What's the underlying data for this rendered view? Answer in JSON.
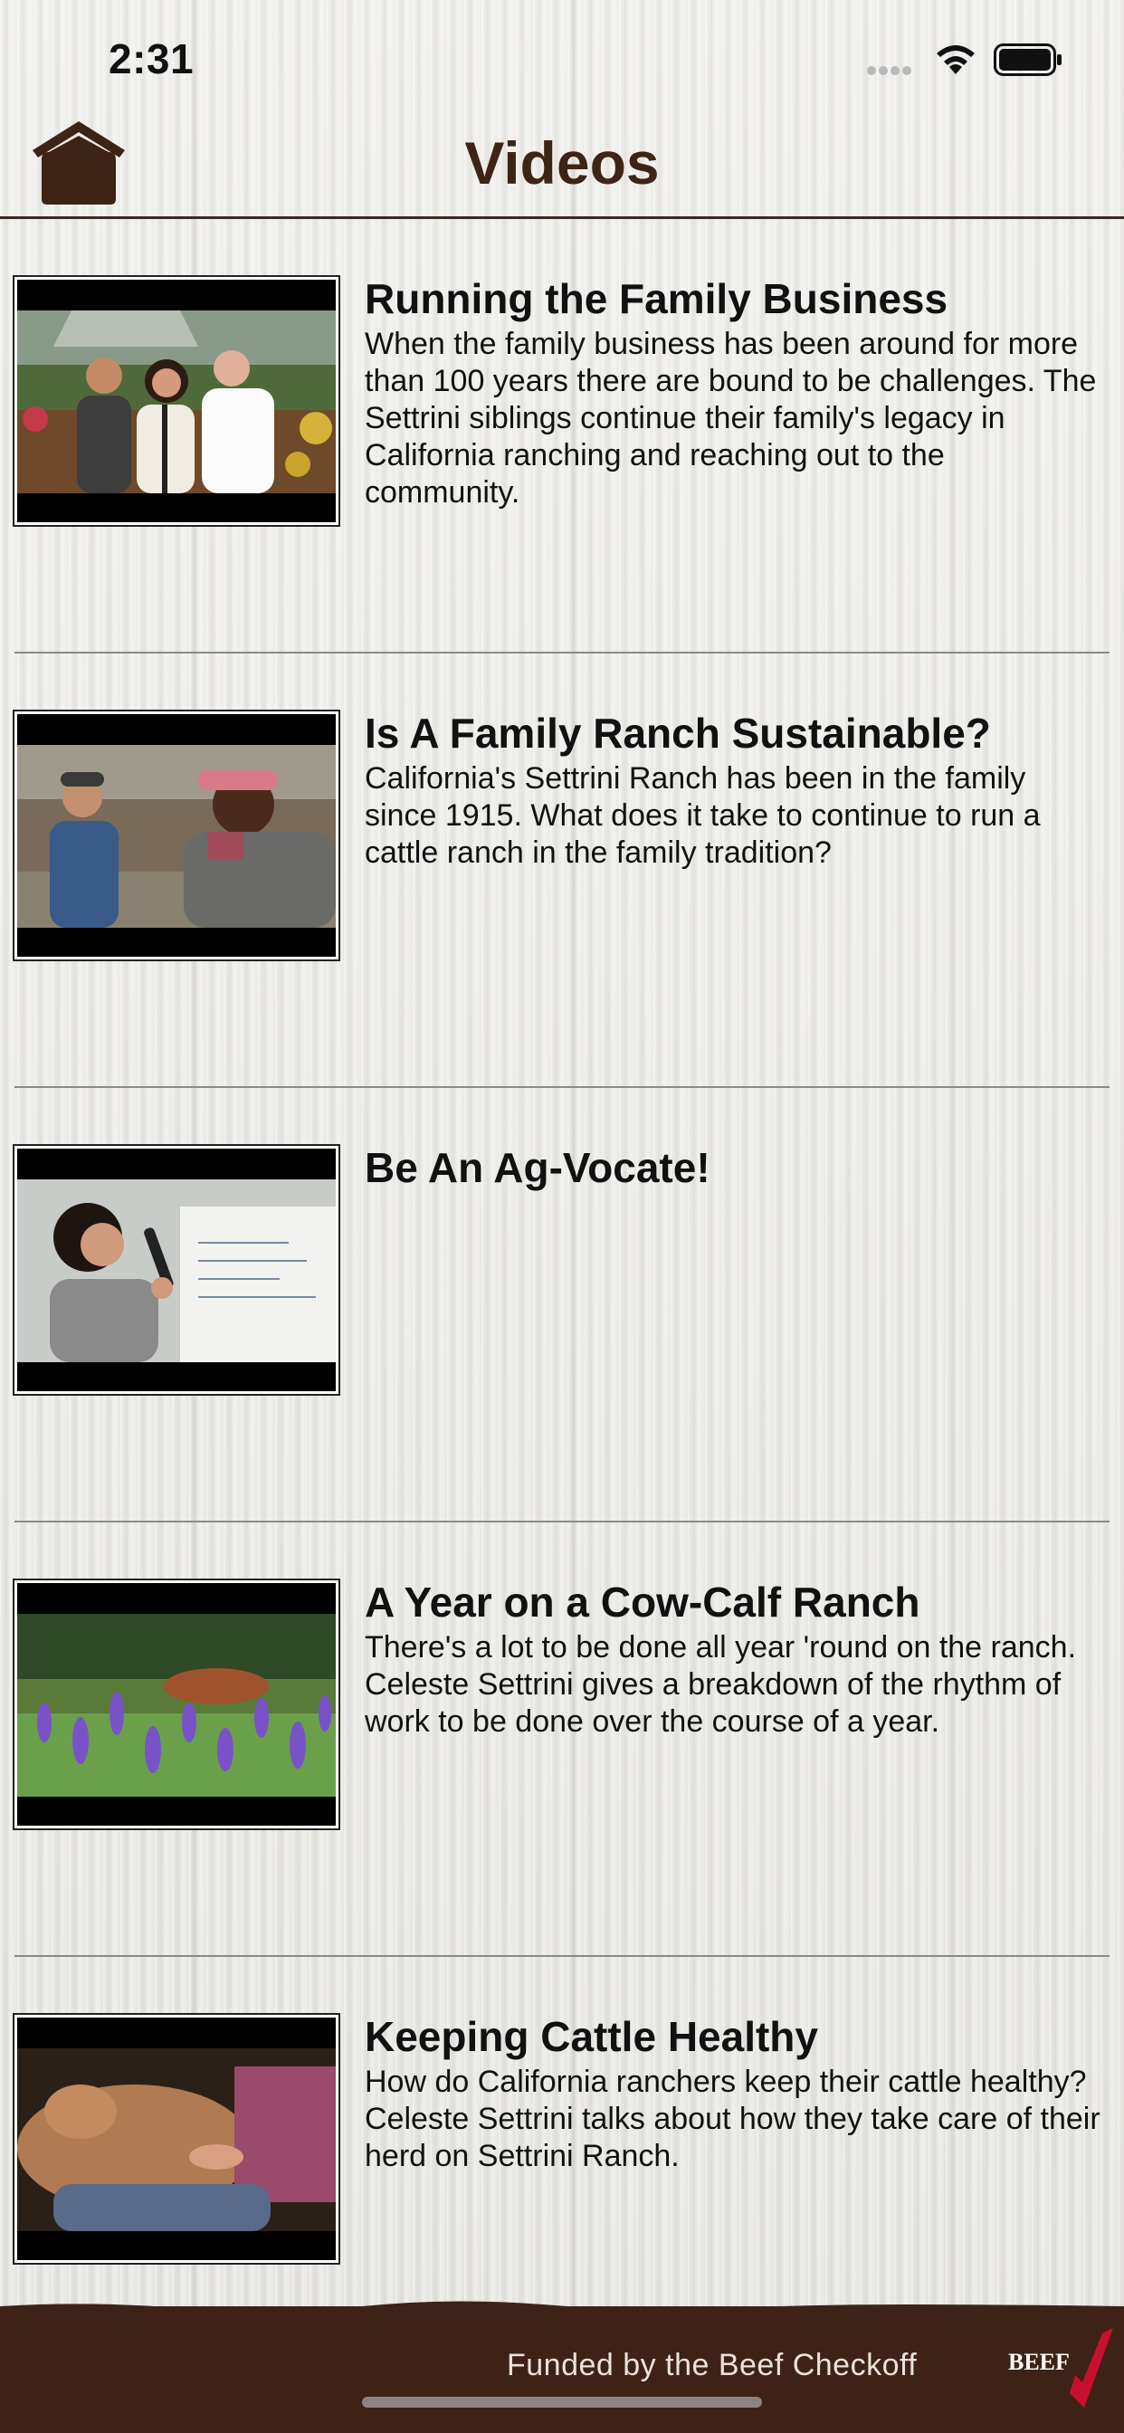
{
  "status_bar": {
    "time": "2:31"
  },
  "header": {
    "title": "Videos",
    "home_icon": "home-icon"
  },
  "videos": [
    {
      "title": "Running the Family Business",
      "description": "When the family business has been around for more than 100 years there are bound to be challenges. The Settrini siblings continue their family's legacy in California ranching and reaching out to the community."
    },
    {
      "title": "Is A Family Ranch Sustainable?",
      "description": "California's Settrini Ranch has been in the family since 1915. What does it take to continue to run a cattle ranch in the family tradition?"
    },
    {
      "title": "Be An Ag-Vocate!",
      "description": ""
    },
    {
      "title": "A Year on a Cow-Calf Ranch",
      "description": "There's a lot to be done all year 'round on the ranch. Celeste Settrini gives a breakdown of the rhythm of work to be done over the course of a year."
    },
    {
      "title": "Keeping Cattle Healthy",
      "description": "How do California ranchers keep their cattle healthy? Celeste Settrini talks about how they take care of their herd on Settrini Ranch."
    }
  ],
  "footer": {
    "funded_text": "Funded by the Beef Checkoff",
    "logo_text": "BEEF"
  },
  "colors": {
    "header_brown": "#3d2416",
    "footer_brown": "#3e2218",
    "logo_red": "#c8102e"
  }
}
